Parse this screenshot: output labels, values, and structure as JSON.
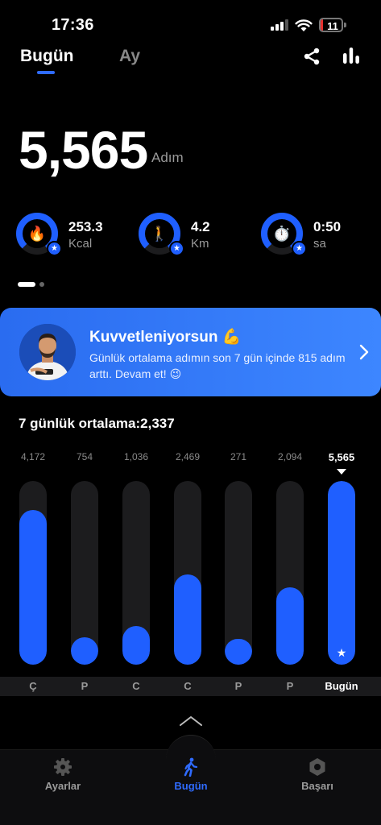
{
  "status_bar": {
    "time": "17:36",
    "battery": "11",
    "battery_level": 0.11
  },
  "header": {
    "tabs": [
      {
        "label": "Bugün",
        "active": true
      },
      {
        "label": "Ay",
        "active": false
      }
    ],
    "icons": [
      "share-icon",
      "bar-chart-icon"
    ]
  },
  "steps": {
    "value": "5,565",
    "unit": "Adım"
  },
  "metrics": [
    {
      "name": "calories",
      "icon": "fire-icon",
      "emoji": "🔥",
      "value": "253.3",
      "unit": "Kcal",
      "progress": 0.78
    },
    {
      "name": "distance",
      "icon": "walking-person-icon",
      "emoji": "🚶",
      "value": "4.2",
      "unit": "Km",
      "progress": 0.78
    },
    {
      "name": "duration",
      "icon": "stopwatch-icon",
      "emoji": "⏱️",
      "value": "0:50",
      "unit": "sa",
      "progress": 0.78
    }
  ],
  "card": {
    "title": "Kuvvetleniyorsun 💪",
    "text": "Günlük ortalama adımın son 7 gün içinde 815 adım arttı. Devam et! 😉"
  },
  "week": {
    "title": "7 günlük ortalama:2,337"
  },
  "chart_data": {
    "type": "bar",
    "categories": [
      "Ç",
      "P",
      "C",
      "C",
      "P",
      "P",
      "Bugün"
    ],
    "values": [
      4172,
      754,
      1036,
      2469,
      271,
      2094,
      5565
    ],
    "value_labels": [
      "4,172",
      "754",
      "1,036",
      "2,469",
      "271",
      "2,094",
      "5,565"
    ],
    "fill_fractions": [
      0.84,
      0.15,
      0.21,
      0.49,
      0.14,
      0.42,
      1.0
    ],
    "highlight_index": 6,
    "colors": {
      "bar": "#1f5fff",
      "track": "#1c1c1e"
    }
  },
  "nav": {
    "items": [
      {
        "label": "Ayarlar",
        "icon": "gear-icon",
        "active": false
      },
      {
        "label": "Bugün",
        "icon": "walking-person-icon",
        "active": true
      },
      {
        "label": "Başarı",
        "icon": "achievement-hexagon-icon",
        "active": false
      }
    ]
  },
  "colors": {
    "accent": "#2f6bff",
    "card_gradient_start": "#2a6cf0",
    "card_gradient_end": "#3d86ff",
    "battery": "#e5312f"
  }
}
